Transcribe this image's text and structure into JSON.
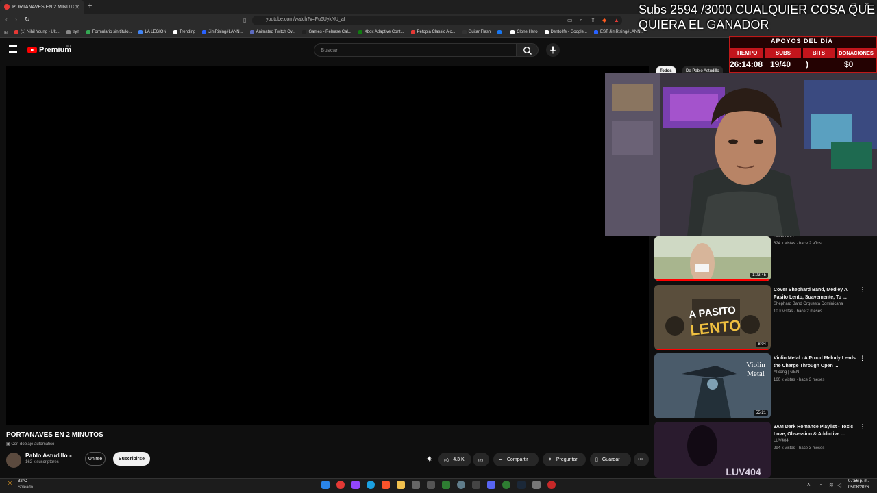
{
  "browser": {
    "tab_title": "PORTANAVES EN 2 MINUTOS",
    "url": "youtube.com/watch?v=Fu6UykNU_aI",
    "bookmarks": [
      {
        "label": "(1) Nihil Young - Ult...",
        "color": "#e53935"
      },
      {
        "label": "tryn",
        "color": "#888888"
      },
      {
        "label": "Formulario sin título...",
        "color": "#34a853"
      },
      {
        "label": "LA LEGION",
        "color": "#4285f4"
      },
      {
        "label": "Trending",
        "color": "#ffffff"
      },
      {
        "label": "JimRising#LANN...",
        "color": "#2962ff"
      },
      {
        "label": "Animated Twitch Ov...",
        "color": "#5c6bc0"
      },
      {
        "label": "Games - Release Cal...",
        "color": "#222222"
      },
      {
        "label": "Xbox Adaptive Cont...",
        "color": "#107c10"
      },
      {
        "label": "Petopia Classic A c...",
        "color": "#e53935"
      },
      {
        "label": "Guitar Flash",
        "color": "#333333"
      },
      {
        "label": "Clone Hero",
        "color": "#ffffff"
      },
      {
        "label": "Dentolife - Google...",
        "color": "#ffffff"
      },
      {
        "label": "EST JimRising#LANN...",
        "color": "#2962ff"
      }
    ]
  },
  "youtube": {
    "brand": "Premium",
    "country": "MX",
    "search_placeholder": "Buscar"
  },
  "video": {
    "title": "PORTANAVES EN 2 MINUTOS",
    "dubbing": "Con doblaje automático",
    "channel": "Pablo Astudillo",
    "subscribers": "162 k suscriptores",
    "join_label": "Unirse",
    "subscribe_label": "Suscribirse",
    "likes": "4.3 K",
    "share_label": "Compartir",
    "ask_label": "Preguntar",
    "save_label": "Guardar"
  },
  "chips": {
    "all": "Todos",
    "from": "De Pablo Astudillo"
  },
  "related": [
    {
      "title": "",
      "channel": "XENIA DIA",
      "meta": "624 k vistas · hace 2 años",
      "duration": "1:03:45",
      "color": "#d9d2c6"
    },
    {
      "title": "Cover Shephard Band, Medley A Pasito Lento, Suavemente, Tu ...",
      "channel": "Shephard Band Orquesta Dominicana",
      "meta": "10 k vistas · hace 2 meses",
      "duration": "8:04",
      "color": "#3c352b"
    },
    {
      "title": "Violin Metal - A Proud Melody Leads the Charge Through Open ...",
      "channel": "AlSong | GEN",
      "meta": "160 k vistas · hace 3 meses",
      "duration": "55:21",
      "color": "#3f4f5c"
    },
    {
      "title": "3AM Dark Romance Playlist - Toxic Love, Obsession & Addictive ...",
      "channel": "LUV404",
      "meta": "294 k vistas · hace 3 meses",
      "duration": "",
      "color": "#2a1b2e"
    }
  ],
  "overlay": {
    "goal_text": "Subs 2594 /3000 CUALQUIER COSA QUE QUIERA EL GANADOR",
    "header": "APOYOS DEL DÍA",
    "labels": [
      "TIEMPO",
      "SUBS",
      "BITS",
      "DONACIONES"
    ],
    "values": [
      "26:14:08",
      "19/40",
      ")",
      "$0"
    ]
  },
  "taskbar": {
    "weather_temp": "32°C",
    "weather_desc": "Soleado",
    "time": "07:56 p. m.",
    "date": "05/08/2026"
  }
}
